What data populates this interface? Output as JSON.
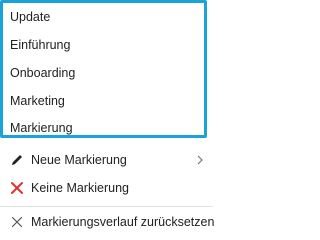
{
  "gallery": {
    "items": [
      {
        "label": "Update"
      },
      {
        "label": "Einführung"
      },
      {
        "label": "Onboarding"
      },
      {
        "label": "Marketing"
      },
      {
        "label": "Markierung"
      }
    ]
  },
  "actions": {
    "new_label": "Neue Markierung",
    "none_label": "Keine Markierung",
    "reset_label": "Markierungsverlauf zurücksetzen"
  },
  "colors": {
    "accent_border": "#1aa3d6",
    "pencil_icon": "#222222",
    "none_icon": "#e03030",
    "reset_icon": "#555555"
  },
  "icons": {
    "new": "pencil-icon",
    "none": "red-x-icon",
    "reset": "x-icon",
    "submenu": "chevron-right-icon"
  }
}
